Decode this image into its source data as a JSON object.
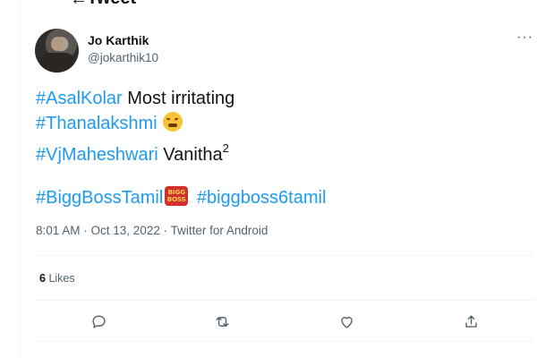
{
  "header": {
    "title": "Tweet"
  },
  "tweet": {
    "author": {
      "display_name": "Jo Karthik",
      "handle": "@jokarthik10"
    },
    "lines": {
      "l1_tag": "#AsalKolar",
      "l1_text": " Most irritating",
      "l2_tag": "#Thanalakshmi",
      "l3_tag": "#VjMaheshwari",
      "l3_text": " Vanitha",
      "l3_sup": "2",
      "l4_tag1": "#BiggBossTamil",
      "l4_tag2": "#biggboss6tamil"
    },
    "badge": {
      "top": "BIGG",
      "bottom": "BOSS"
    },
    "timestamp": "8:01 AM · Oct 13, 2022",
    "separator": "·",
    "source": "Twitter for Android",
    "likes": {
      "count": "6",
      "label": "Likes"
    }
  },
  "icons": {
    "more": "more-icon",
    "reply": "reply-icon",
    "retweet": "retweet-icon",
    "like": "like-icon",
    "share": "share-icon"
  },
  "colors": {
    "accent": "#1d9bf0",
    "text": "#0f1419",
    "secondary": "#536471",
    "divider": "#eff3f4"
  }
}
